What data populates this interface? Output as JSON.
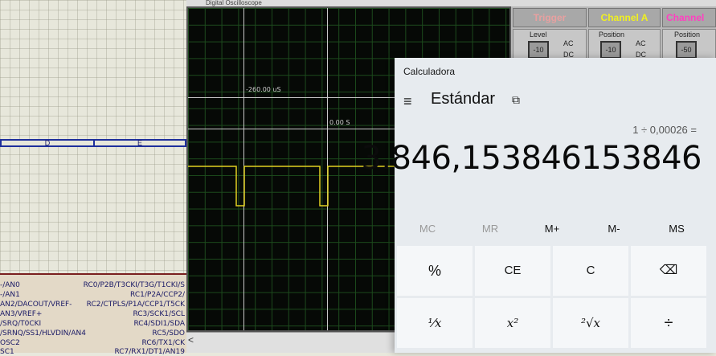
{
  "osc": {
    "title": "Digital Oscilloscope",
    "cursor_left_label": "-260.00 uS",
    "cursor_right_label": "0.00 S",
    "scroll_left": "<"
  },
  "schematic": {
    "bus_labels": [
      "D",
      "E"
    ],
    "pins_left": [
      "-/AN0",
      "-/AN1",
      "AN2/DACOUT/VREF-",
      "AN3/VREF+",
      "/SRQ/T0CKI",
      "/SRNQ/SS1/HLVDIN/AN4",
      "OSC2",
      "SC1"
    ],
    "pins_right": [
      "RC0/P2B/T3CKI/T3G/T1CKI/S",
      "RC1/P2A/CCP2/",
      "RC2/CTPLS/P1A/CCP1/T5CK",
      "RC3/SCK1/SCL",
      "RC4/SDI1/SDA",
      "RC5/SDO",
      "RC6/TX1/CK",
      "RC7/RX1/DT1/AN19"
    ]
  },
  "panel": {
    "trigger": {
      "label": "Trigger",
      "sub": "Level",
      "knob": "-10",
      "ac": "AC",
      "dc": "DC"
    },
    "channel_a": {
      "label": "Channel A",
      "sub": "Position",
      "knob": "-10",
      "ac": "AC",
      "dc": "DC"
    },
    "channel_b": {
      "label": "Channel",
      "sub": "Position",
      "knob": "-50"
    }
  },
  "calc": {
    "title": "Calculadora",
    "menu_icon": "≡",
    "mode": "Estándar",
    "keep_on_top_icon": "⧉",
    "expression": "1 ÷ 0,00026 =",
    "display": "3.846,153846153846",
    "memory": [
      "MC",
      "MR",
      "M+",
      "M-",
      "MS"
    ],
    "keys_row1": [
      "%",
      "CE",
      "C",
      "⌫"
    ],
    "keys_row2": [
      "¹⁄x",
      "x²",
      "²√x",
      "÷"
    ]
  },
  "colors": {
    "trace": "#e0d020",
    "trigger_label": "#e8a0a0",
    "channel_a_label": "#f0f020",
    "channel_b_label": "#ff40c0"
  }
}
